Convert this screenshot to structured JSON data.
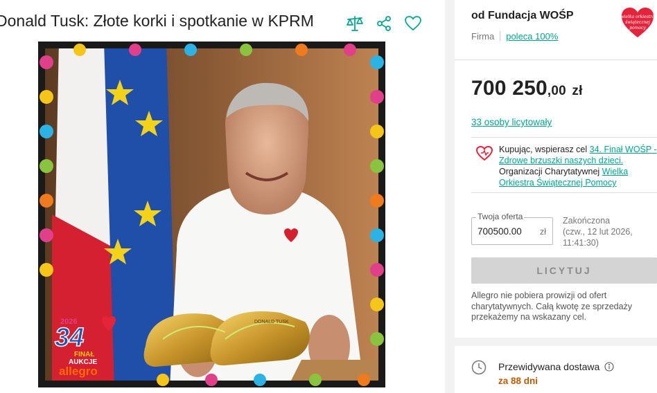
{
  "offer": {
    "title": "Donald Tusk: Złote korki i spotkanie w KPRM"
  },
  "toolbar": {
    "compare_icon": "scales-icon",
    "share_icon": "share-icon",
    "favorite_icon": "heart-icon"
  },
  "image": {
    "badge_year": "2026",
    "badge_number": "34",
    "badge_final": "FINAŁ",
    "badge_auction": "AUKCJE",
    "badge_brand": "allegro",
    "shoe_text": "DONALD TUSK"
  },
  "seller": {
    "name": "od Fundacja WOŚP",
    "type": "Firma",
    "recommend": "poleca 100%",
    "logo_text": "wielka orkiestra świątecznej pomocy"
  },
  "auction": {
    "price_main": "700 250",
    "price_cents": ",00",
    "price_currency": "zł",
    "bidders": "33 osoby licytowały",
    "charity_prefix": "Kupując, wspierasz cel ",
    "charity_goal": "34. Finał WOŚP - Zdrowe brzuszki naszych dzieci.",
    "charity_org_prefix": "Organizacji Charytatywnej ",
    "charity_org": "Wielka Orkiestra Świątecznej Pomocy",
    "bid_label": "Twoja oferta",
    "bid_value": "700500.00",
    "bid_currency": "zł",
    "status": "Zakończona",
    "end_date": "(czw., 12 lut 2026, 11:41:30)",
    "bid_button": "LICYTUJ",
    "note": "Allegro nie pobiera prowizji od ofert charytatywnych. Całą kwotę ze sprzedaży przekażemy na wskazany cel."
  },
  "delivery": {
    "title": "Przewidywana dostawa",
    "days": "za 88 dni"
  },
  "colors": {
    "accent": "#00a790",
    "heart": "#e5243b",
    "disabled": "#d4d4d4",
    "delivery": "#c05a00"
  }
}
